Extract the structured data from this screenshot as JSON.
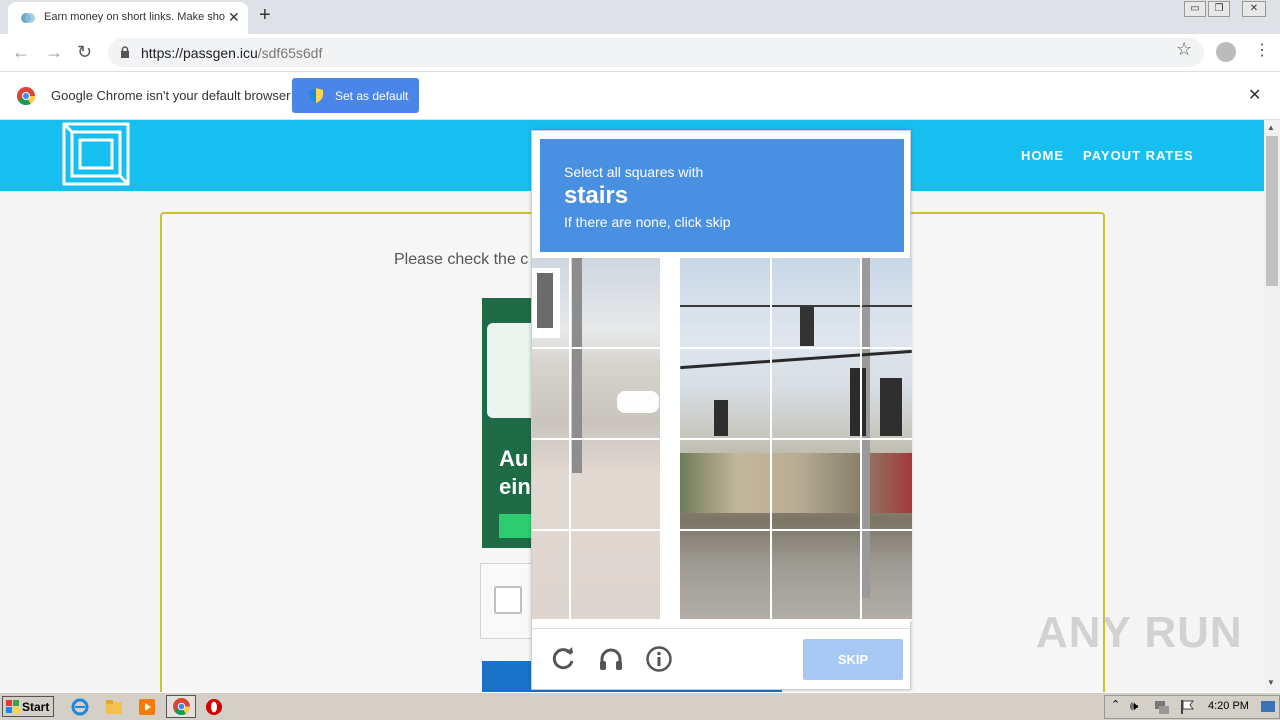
{
  "browser": {
    "tab_title": "Earn money on short links. Make sho",
    "url_host": "https://passgen.icu",
    "url_path": "/sdf65s6df",
    "infobar_message": "Google Chrome isn't your default browser",
    "set_default_label": "Set as default"
  },
  "site": {
    "nav": [
      "HOME",
      "PAYOUT RATES"
    ],
    "please_check": "Please check the c",
    "ad_text_1": "Au",
    "ad_text_2": "ein"
  },
  "captcha": {
    "instruction": "Select all squares with",
    "target": "stairs",
    "hint": "If there are none, click skip",
    "skip_label": "SKIP"
  },
  "watermark": "ANY RUN",
  "taskbar": {
    "start_label": "Start",
    "clock": "4:20 PM"
  },
  "colors": {
    "site_header": "#17bff0",
    "captcha_header": "#4a90e2",
    "skip_button": "#a6c8f3",
    "set_default_button": "#4a86e8"
  }
}
